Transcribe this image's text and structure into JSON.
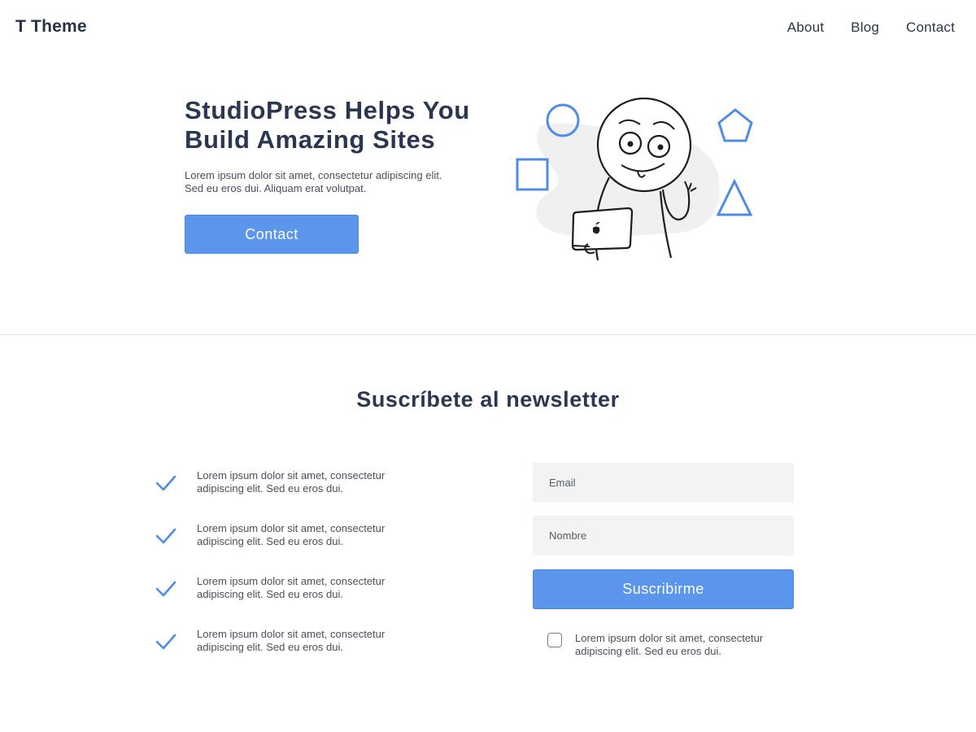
{
  "header": {
    "site_title": "T Theme",
    "nav": [
      "About",
      "Blog",
      "Contact"
    ]
  },
  "hero": {
    "title": "StudioPress Helps You Build Amazing Sites",
    "text": "Lorem ipsum dolor sit amet, consectetur adipiscing elit. Sed eu eros dui. Aliquam erat volutpat.",
    "button_label": "Contact",
    "illustration_icons": [
      "person-with-laptop-illustration",
      "circle-icon",
      "square-icon",
      "pentagon-icon",
      "triangle-icon"
    ]
  },
  "newsletter": {
    "title": "Suscríbete al newsletter",
    "benefits": [
      "Lorem ipsum dolor sit amet, consectetur adipiscing elit. Sed eu eros dui.",
      "Lorem ipsum dolor sit amet, consectetur adipiscing elit. Sed eu eros dui.",
      "Lorem ipsum dolor sit amet, consectetur adipiscing elit. Sed eu eros dui.",
      "Lorem ipsum dolor sit amet, consectetur adipiscing elit. Sed eu eros dui."
    ],
    "email_placeholder": "Email",
    "name_placeholder": "Nombre",
    "submit_label": "Suscribirme",
    "consent_text": "Lorem ipsum dolor sit amet, consectetur adipiscing elit. Sed eu eros dui.",
    "consent_checked": false
  },
  "colors": {
    "accent": "#5b96ec",
    "heading": "#2b3650",
    "field_bg": "#f3f3f4"
  }
}
